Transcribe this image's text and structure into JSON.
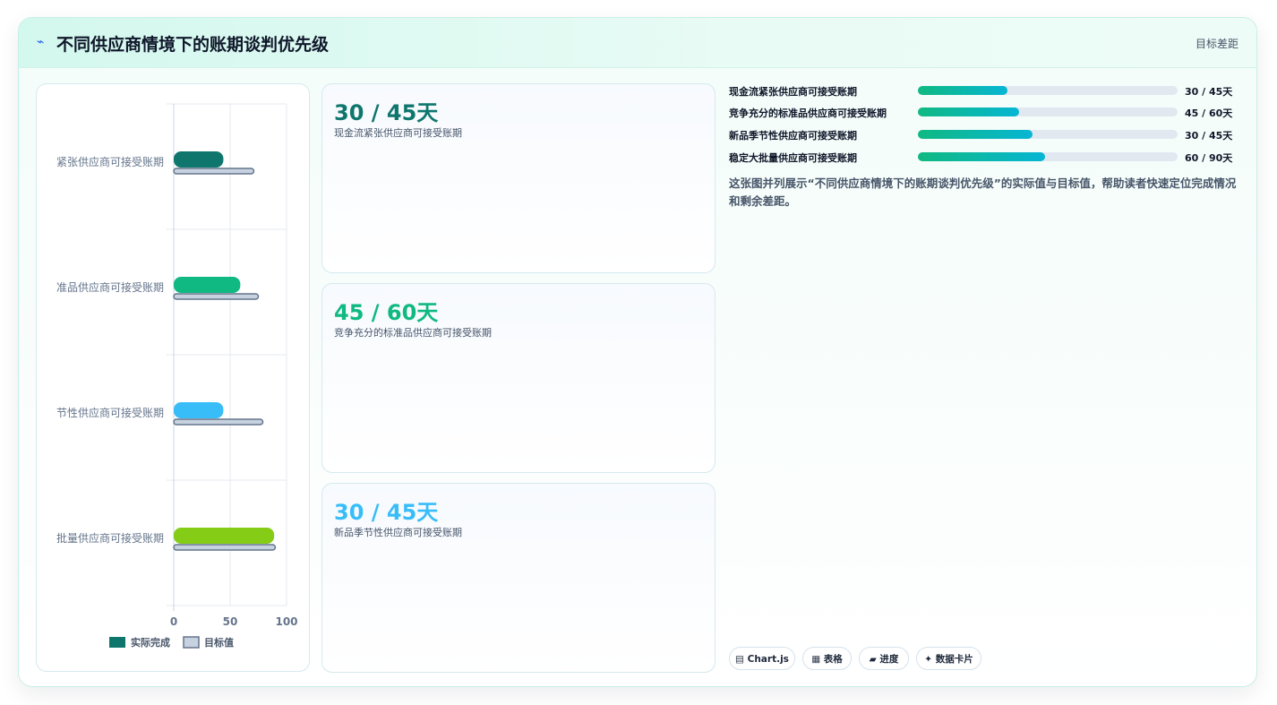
{
  "header": {
    "icon": "pulse-icon",
    "icon_glyph": "⌁",
    "title": "不同供应商情境下的账期谈判优先级",
    "right_label": "目标差距"
  },
  "chart_data": {
    "type": "bar",
    "orientation": "horizontal",
    "categories": [
      "紧张供应商可接受账期",
      "准品供应商可接受账期",
      "节性供应商可接受账期",
      "批量供应商可接受账期"
    ],
    "series": [
      {
        "name": "实际完成",
        "values": [
          44,
          59,
          44,
          89
        ],
        "colors": [
          "#0f766e",
          "#10b981",
          "#38bdf8",
          "#84cc16"
        ]
      },
      {
        "name": "目标值",
        "values": [
          71,
          75,
          79,
          90
        ],
        "color": "#c7d2e0"
      }
    ],
    "xlim": [
      0,
      100
    ],
    "xticks": [
      0,
      50,
      100
    ],
    "grid": true,
    "legend_position": "bottom"
  },
  "stats": [
    {
      "value": "30 / 45天",
      "label": "现金流紧张供应商可接受账期",
      "color": "#0f766e"
    },
    {
      "value": "45 / 60天",
      "label": "竞争充分的标准品供应商可接受账期",
      "color": "#10b981"
    },
    {
      "value": "30 / 45天",
      "label": "新品季节性供应商可接受账期",
      "color": "#38bdf8"
    }
  ],
  "progress": [
    {
      "label": "现金流紧张供应商可接受账期",
      "value_text": "30 / 45天",
      "ratio": 0.345
    },
    {
      "label": "竞争充分的标准品供应商可接受账期",
      "value_text": "45 / 60天",
      "ratio": 0.39
    },
    {
      "label": "新品季节性供应商可接受账期",
      "value_text": "30 / 45天",
      "ratio": 0.44
    },
    {
      "label": "稳定大批量供应商可接受账期",
      "value_text": "60 / 90天",
      "ratio": 0.49
    }
  ],
  "description": "这张图并列展示“不同供应商情境下的账期谈判优先级”的实际值与目标值，帮助读者快速定位完成情况和剩余差距。",
  "tags": [
    {
      "label": "▤ Chart.js"
    },
    {
      "label": "▦ 表格"
    },
    {
      "label": "▰ 进度"
    },
    {
      "label": "✦ 数据卡片"
    }
  ]
}
